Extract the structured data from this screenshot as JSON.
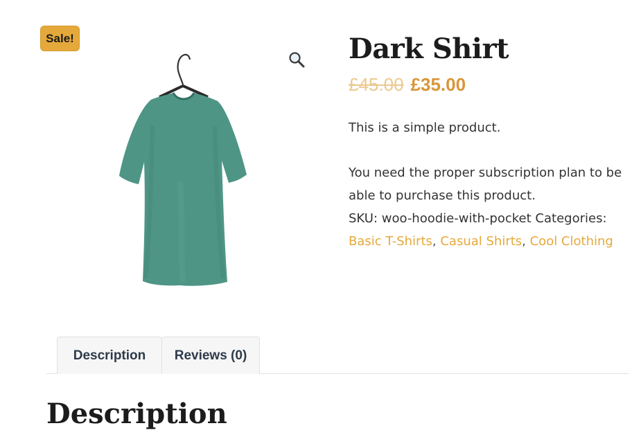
{
  "badge": {
    "label": "Sale!"
  },
  "gallery": {
    "zoom_icon": "magnifier-icon",
    "image_alt": "Dark Shirt"
  },
  "product": {
    "title": "Dark Shirt",
    "price_old": "£45.00",
    "price_new": "£35.00",
    "short_description": "This is a simple product.",
    "subscription_note": "You need the proper subscription plan to be able to purchase this product.",
    "sku_label": "SKU:",
    "sku_value": "woo-hoodie-with-pocket",
    "categories_label": "Categories:",
    "categories": [
      "Basic T-Shirts",
      "Casual Shirts",
      "Cool Clothing"
    ]
  },
  "tabs": [
    {
      "label": "Description"
    },
    {
      "label": "Reviews (0)"
    }
  ],
  "description_heading": "Description",
  "colors": {
    "accent": "#e5a93b",
    "price": "#d9963a",
    "shirt": "#4e9585"
  }
}
